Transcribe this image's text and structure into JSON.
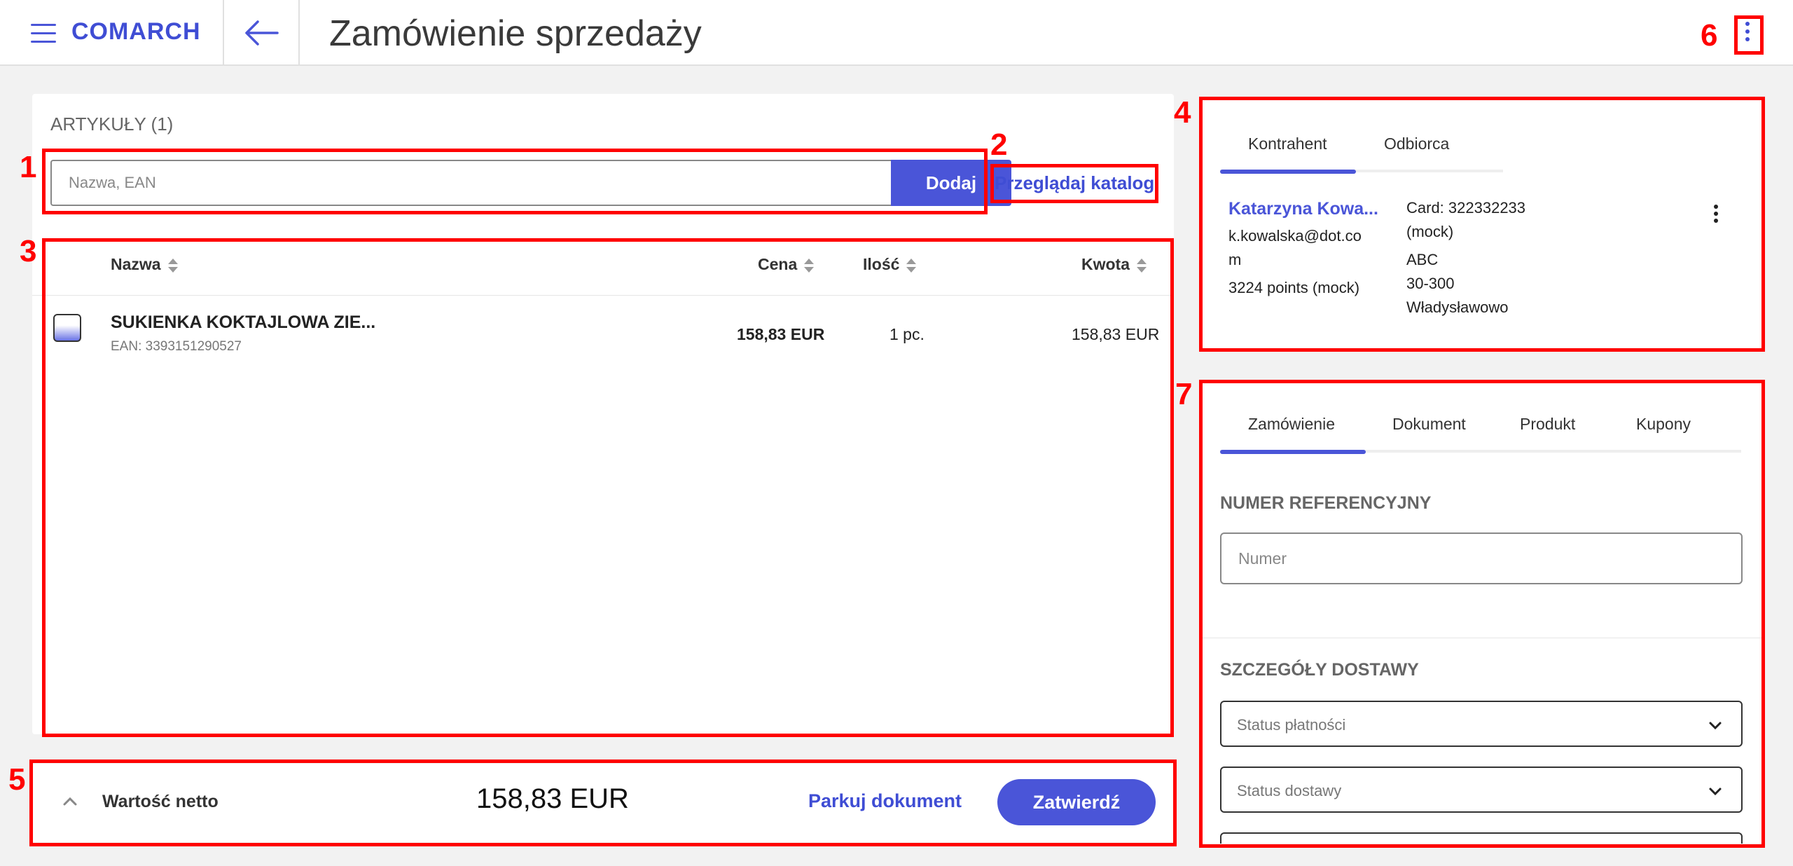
{
  "header": {
    "logo": "COMARCH",
    "title": "Zamówienie sprzedaży"
  },
  "articles": {
    "title": "ARTYKUŁY (1)",
    "search_placeholder": "Nazwa, EAN",
    "add_label": "Dodaj",
    "catalog_label": "Przeglądaj katalog",
    "columns": {
      "name": "Nazwa",
      "price": "Cena",
      "qty": "Ilość",
      "amount": "Kwota"
    },
    "rows": [
      {
        "name": "SUKIENKA KOKTAJLOWA ZIE...",
        "ean": "EAN: 3393151290527",
        "price": "158,83 EUR",
        "qty": "1 pc.",
        "amount": "158,83 EUR"
      }
    ]
  },
  "footer": {
    "net_label": "Wartość netto",
    "net_value": "158,83 EUR",
    "park_label": "Parkuj dokument",
    "confirm_label": "Zatwierdź"
  },
  "customer": {
    "tabs": [
      "Kontrahent",
      "Odbiorca"
    ],
    "name": "Katarzyna Kowa...",
    "email_line1": "k.kowalska@dot.co",
    "email_line2": "m",
    "points": "3224 points (mock)",
    "card_line1": "Card: 322332233",
    "card_line2": "(mock)",
    "address_line1": "ABC",
    "address_line2": "30-300",
    "address_line3": "Władysławowo"
  },
  "order": {
    "tabs": [
      "Zamówienie",
      "Dokument",
      "Produkt",
      "Kupony"
    ],
    "ref_label": "NUMER REFERENCYJNY",
    "ref_placeholder": "Numer",
    "delivery_label": "SZCZEGÓŁY DOSTAWY",
    "payment_status": "Status płatności",
    "delivery_status": "Status dostawy"
  },
  "annotations": [
    "1",
    "2",
    "3",
    "4",
    "5",
    "6",
    "7"
  ],
  "colors": {
    "accent": "#4a55d8",
    "annotation": "#ff0000"
  }
}
